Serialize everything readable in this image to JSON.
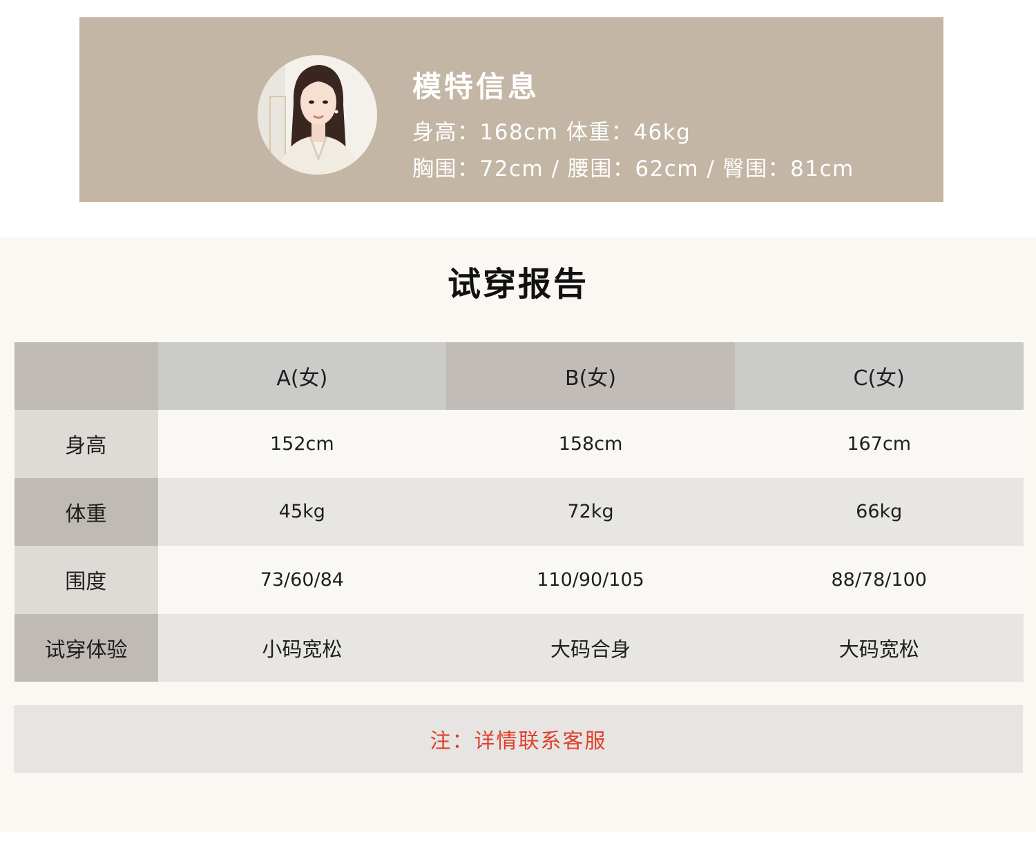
{
  "model_info": {
    "title": "模特信息",
    "line1": "身高：168cm  体重：46kg",
    "line2": "胸围：72cm / 腰围：62cm / 臀围：81cm"
  },
  "report": {
    "title": "试穿报告",
    "columns": [
      "A(女)",
      "B(女)",
      "C(女)"
    ],
    "rows": [
      {
        "label": "身高",
        "values": [
          "152cm",
          "158cm",
          "167cm"
        ]
      },
      {
        "label": "体重",
        "values": [
          "45kg",
          "72kg",
          "66kg"
        ]
      },
      {
        "label": "围度",
        "values": [
          "73/60/84",
          "110/90/105",
          "88/78/100"
        ]
      },
      {
        "label": "试穿体验",
        "values": [
          "小码宽松",
          "大码合身",
          "大码宽松"
        ]
      }
    ],
    "note": "注：详情联系客服"
  },
  "colors": {
    "banner": "#c3b6a5",
    "section_bg": "#fbf8f4",
    "note": "#e0402a"
  }
}
